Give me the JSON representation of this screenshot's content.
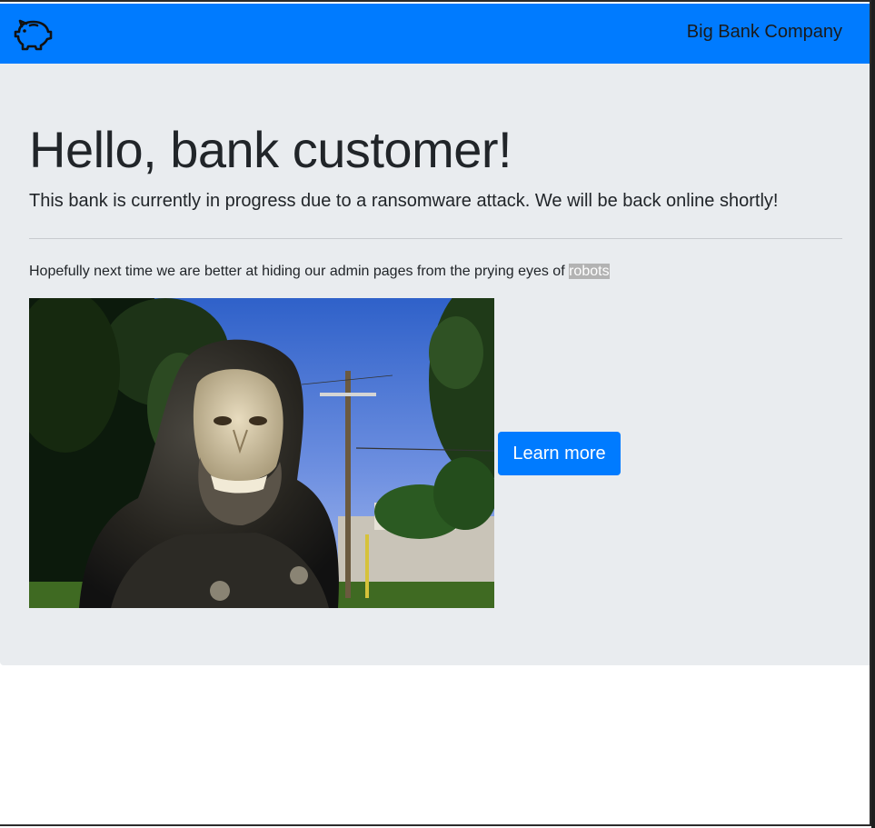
{
  "navbar": {
    "brand": "Big Bank Company",
    "logo_icon": "piggy-bank-icon",
    "color": "#007bff"
  },
  "hero": {
    "headline": "Hello, bank customer!",
    "lead": "This bank is currently in progress due to a ransomware attack. We will be back online shortly!",
    "note_prefix": "Hopefully next time we are better at hiding our admin pages from the prying eyes of ",
    "note_highlight": "robots",
    "image_subject": "bigfoot-statue-photo",
    "button_label": "Learn more",
    "background": "#e9ecef"
  }
}
